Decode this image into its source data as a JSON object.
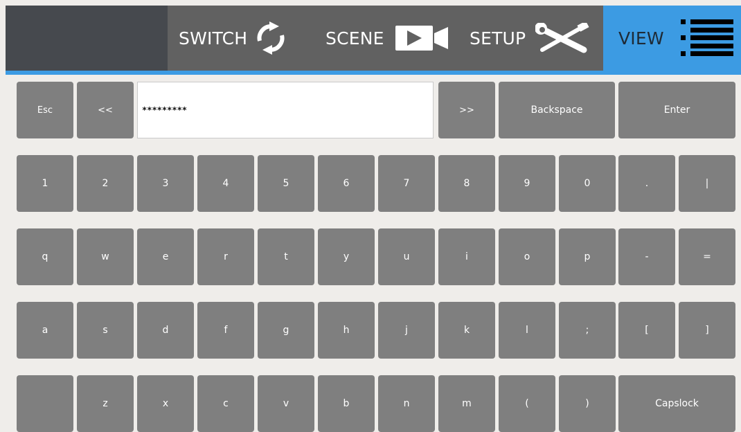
{
  "nav": {
    "switch_label": "SWITCH",
    "scene_label": "SCENE",
    "setup_label": "SETUP",
    "view_label": "VIEW",
    "icons": [
      "rotate-arrows-icon",
      "video-camera-icon",
      "tools-icon",
      "menu-icon"
    ],
    "colors": {
      "bar": "#616161",
      "left_block": "#46494e",
      "active": "#3c9be3"
    }
  },
  "keyboard": {
    "field_value": "*********",
    "controls": {
      "esc": "Esc",
      "left": "<<",
      "right": ">>",
      "backspace": "Backspace",
      "enter": "Enter",
      "capslock": "Capslock"
    },
    "rows": [
      [
        "1",
        "2",
        "3",
        "4",
        "5",
        "6",
        "7",
        "8",
        "9",
        "0",
        ".",
        "|"
      ],
      [
        "q",
        "w",
        "e",
        "r",
        "t",
        "y",
        "u",
        "i",
        "o",
        "p",
        "-",
        "="
      ],
      [
        "a",
        "s",
        "d",
        "f",
        "g",
        "h",
        "j",
        "k",
        "l",
        ";",
        "[",
        "]"
      ],
      [
        "",
        "z",
        "x",
        "c",
        "v",
        "b",
        "n",
        "m",
        "(",
        ")"
      ]
    ],
    "colors": {
      "key": "#7f7f7f",
      "background": "#efedea"
    }
  }
}
